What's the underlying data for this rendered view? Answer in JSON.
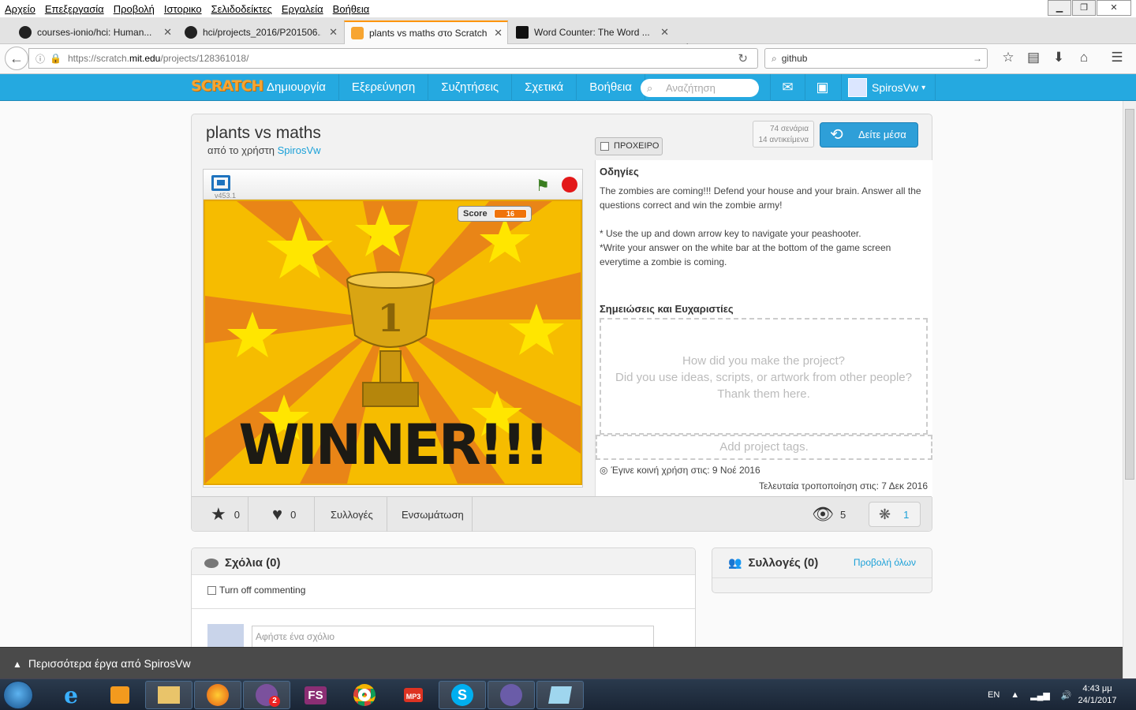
{
  "menubar": [
    "Αρχείο",
    "Επεξεργασία",
    "Προβολή",
    "Ιστορικο",
    "Σελιδοδείκτες",
    "Εργαλεία",
    "Βοήθεια"
  ],
  "tabs": [
    {
      "label": "courses-ionio/hci: Human...",
      "icon": "github-icon"
    },
    {
      "label": "hci/projects_2016/P201506...",
      "icon": "github-icon"
    },
    {
      "label": "plants vs maths στο Scratch",
      "icon": "scratch-icon",
      "active": true
    },
    {
      "label": "Word Counter: The Word ...",
      "icon": "wordcounter-icon"
    }
  ],
  "url": {
    "prefix": "https://scratch.",
    "domain": "mit.edu",
    "path": "/projects/128361018/"
  },
  "search_value": "github",
  "scratch": {
    "logo": "SCRATCH",
    "nav": [
      "Δημιουργία",
      "Εξερεύνηση",
      "Συζητήσεις",
      "Σχετικά",
      "Βοήθεια"
    ],
    "search_placeholder": "Αναζήτηση",
    "username": "SpirosVw",
    "username_caret": "▾"
  },
  "project": {
    "title": "plants vs maths",
    "by_prefix": "από το χρήστη",
    "author": "SpirosVw",
    "draft_label": "ΠΡΟΧΕΙΡΟ",
    "scripts_count": "74 σενάρια",
    "sprites_count": "14 αντικείμενα",
    "see_inside": "Δείτε μέσα",
    "version": "v453.1",
    "score_label": "Score",
    "score_value": "16",
    "stage_text": "WINNER!!!",
    "stars": "0",
    "loves": "0",
    "collections_label": "Συλλογές",
    "embed_label": "Ενσωμάτωση",
    "views": "5",
    "remixes": "1",
    "instructions_heading": "Οδηγίες",
    "instructions": "The zombies are coming!!! Defend your house and your brain. Answer all the questions correct and win the zombie army!\n\n* Use the up and down arrow key to navigate your peashooter.\n*Write your answer on the white bar at the bottom of the game screen everytime a zombie is coming.",
    "notes_heading": "Σημειώσεις και Ευχαριστίες",
    "notes_placeholder": "How did you make the project?\nDid you use ideas, scripts, or artwork from other people? Thank them here.",
    "tags_placeholder": "Add project tags.",
    "shared_date": "Έγινε κοινή χρήση στις: 9 Νοέ 2016",
    "modified_date": "Τελευταία τροποποίηση στις: 7 Δεκ 2016"
  },
  "comments": {
    "heading": "Σχόλια (0)",
    "turn_off": "Turn off commenting",
    "placeholder": "Αφήστε ένα σχόλιο"
  },
  "collections": {
    "heading": "Συλλογές (0)",
    "view_all": "Προβολή όλων"
  },
  "more_projects": "Περισσότερα έργα από SpirosVw",
  "taskbar": {
    "lang": "EN",
    "time": "4:43 μμ",
    "date": "24/1/2017",
    "apps": [
      "ie-icon",
      "media-player-icon",
      "file-explorer-icon",
      "firefox-icon",
      "viber-icon",
      "fs-icon",
      "chrome-icon",
      "mp3-icon",
      "skype-icon",
      "scratch-cat-icon",
      "notes-icon"
    ],
    "viber_badge": "2",
    "fs_label": "FS",
    "mp3_label": "MP3"
  },
  "colors": {
    "scratch_blue": "#25a9e0",
    "see_inside": "#2e9fd8",
    "stage_bg": "#f6bc00",
    "link": "#1aa0d8"
  }
}
